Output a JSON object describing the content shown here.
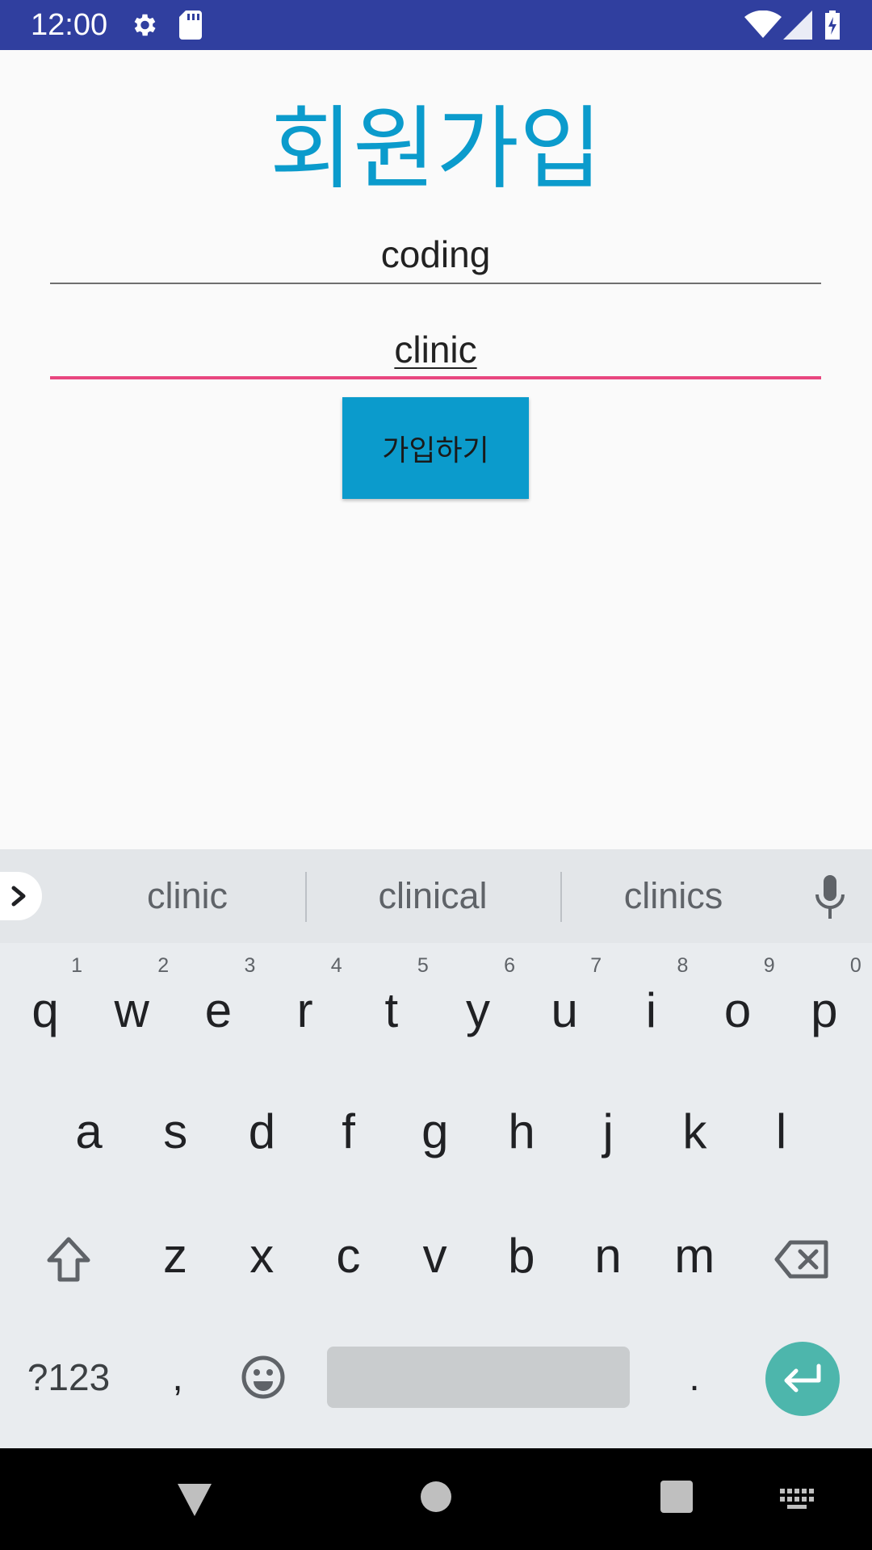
{
  "status_bar": {
    "time": "12:00",
    "icons": [
      "settings-icon",
      "sd-card-icon",
      "wifi-icon",
      "signal-icon",
      "battery-charging-icon"
    ]
  },
  "app": {
    "title": "회원가입",
    "id_field": {
      "value": "coding"
    },
    "password_field": {
      "value": "clinic"
    },
    "signup_button": {
      "label": "가입하기"
    }
  },
  "keyboard": {
    "suggestions": [
      "clinic",
      "clinical",
      "clinics"
    ],
    "row1": [
      {
        "letter": "q",
        "hint": "1"
      },
      {
        "letter": "w",
        "hint": "2"
      },
      {
        "letter": "e",
        "hint": "3"
      },
      {
        "letter": "r",
        "hint": "4"
      },
      {
        "letter": "t",
        "hint": "5"
      },
      {
        "letter": "y",
        "hint": "6"
      },
      {
        "letter": "u",
        "hint": "7"
      },
      {
        "letter": "i",
        "hint": "8"
      },
      {
        "letter": "o",
        "hint": "9"
      },
      {
        "letter": "p",
        "hint": "0"
      }
    ],
    "row2": [
      "a",
      "s",
      "d",
      "f",
      "g",
      "h",
      "j",
      "k",
      "l"
    ],
    "row3": [
      "z",
      "x",
      "c",
      "v",
      "b",
      "n",
      "m"
    ],
    "symbols_label": "?123",
    "comma_label": ",",
    "period_label": "."
  },
  "colors": {
    "status_bar": "#303f9f",
    "title": "#0b9bcc",
    "button": "#0b9bcc",
    "focused_underline": "#e8467f",
    "enter_key": "#4db6ac"
  }
}
